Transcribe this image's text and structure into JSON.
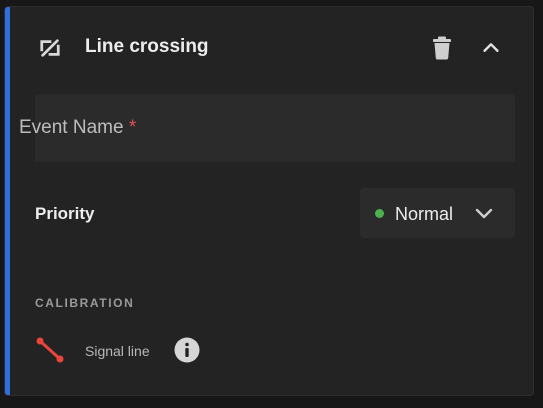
{
  "card": {
    "title": "Line crossing",
    "accent_color": "#2f6ee0",
    "icons": {
      "header": "line-crossing-icon",
      "delete": "trash-icon",
      "collapse": "chevron-up-icon"
    }
  },
  "event_name": {
    "label": "Event Name",
    "required_marker": "*",
    "value": ""
  },
  "priority": {
    "label": "Priority",
    "selected": "Normal",
    "status_color": "#4caf50",
    "icon": "chevron-down-icon"
  },
  "calibration": {
    "section_label": "CALIBRATION",
    "items": [
      {
        "label": "Signal line",
        "icon": "signal-line-icon",
        "icon_color": "#e8463a",
        "info_icon": "info-icon"
      }
    ]
  }
}
